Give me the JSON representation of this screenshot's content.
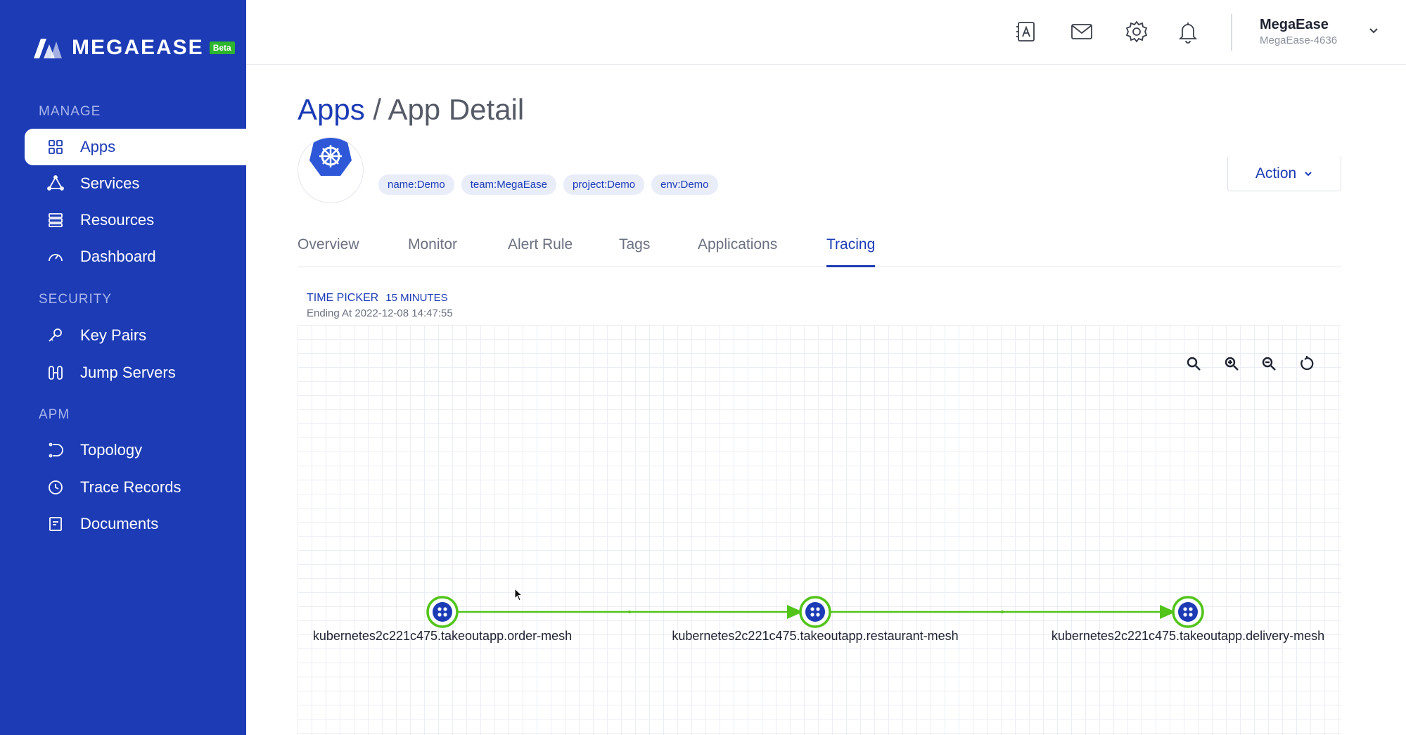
{
  "sidebar": {
    "brand": "MEGAEASE",
    "beta": "Beta",
    "sections": [
      {
        "title": "MANAGE"
      },
      {
        "title": "SECURITY"
      },
      {
        "title": "APM"
      }
    ],
    "items": [
      {
        "label": "Apps",
        "icon": "grid-icon"
      },
      {
        "label": "Services",
        "icon": "services-icon"
      },
      {
        "label": "Resources",
        "icon": "resources-icon"
      },
      {
        "label": "Dashboard",
        "icon": "dashboard-icon"
      },
      {
        "label": "Key Pairs",
        "icon": "key-icon"
      },
      {
        "label": "Jump Servers",
        "icon": "jump-server-icon"
      },
      {
        "label": "Topology",
        "icon": "topology-icon"
      },
      {
        "label": "Trace Records",
        "icon": "clock-icon"
      },
      {
        "label": "Documents",
        "icon": "document-icon"
      }
    ],
    "active": "Apps"
  },
  "header": {
    "user_name": "MegaEase",
    "user_org": "MegaEase-4636"
  },
  "breadcrumb": {
    "parent": "Apps",
    "separator": " / ",
    "current": "App Detail"
  },
  "app": {
    "tags": [
      "name:Demo",
      "team:MegaEase",
      "project:Demo",
      "env:Demo"
    ],
    "action_label": "Action"
  },
  "tabs": [
    {
      "label": "Overview"
    },
    {
      "label": "Monitor"
    },
    {
      "label": "Alert Rule"
    },
    {
      "label": "Tags"
    },
    {
      "label": "Applications"
    },
    {
      "label": "Tracing"
    }
  ],
  "active_tab": "Tracing",
  "tracing": {
    "time_picker_label": "TIME PICKER",
    "time_picker_value": "15 MINUTES",
    "ending_at": "Ending At 2022-12-08 14:47:55",
    "nodes": [
      {
        "label": "kubernetes2c221c475.takeoutapp.order-mesh"
      },
      {
        "label": "kubernetes2c221c475.takeoutapp.restaurant-mesh"
      },
      {
        "label": "kubernetes2c221c475.takeoutapp.delivery-mesh"
      }
    ]
  },
  "colors": {
    "sidebar": "#1c3bb5",
    "accent": "#1c3bb5",
    "edge": "#52c41a",
    "beta": "#2db52d"
  }
}
